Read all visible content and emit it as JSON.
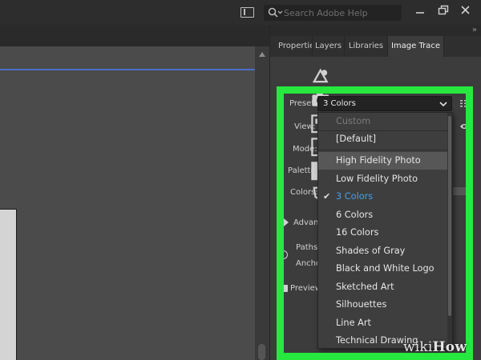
{
  "help_search": {
    "placeholder": "Search Adobe Help",
    "icon": "search-icon"
  },
  "window_controls": [
    "minimize-icon",
    "restore-icon",
    "close-icon"
  ],
  "panel_tabs": [
    {
      "label": "Propertie",
      "active": false
    },
    {
      "label": "Layers",
      "active": false
    },
    {
      "label": "Libraries",
      "active": false
    },
    {
      "label": "Image Trace",
      "active": true
    }
  ],
  "preset_icons": [
    "auto-color-icon",
    "high-color-icon",
    "low-color-icon",
    "grayscale-icon",
    "black-white-icon",
    "outline-icon"
  ],
  "image_trace": {
    "preset_label": "Preset:",
    "preset_value": "3 Colors",
    "view_label": "View:",
    "mode_label": "Mode:",
    "palette_label": "Palette:",
    "colors_label": "Colors:",
    "advanced_label": "Advanc",
    "paths_label": "Paths",
    "anchors_label": "Ancho",
    "preview_label": "Preview"
  },
  "preset_dropdown": {
    "items": [
      {
        "label": "Custom",
        "disabled": true
      },
      {
        "label": "[Default]"
      },
      {
        "label": "High Fidelity Photo",
        "hover": true
      },
      {
        "label": "Low Fidelity Photo"
      },
      {
        "label": "3 Colors",
        "checked": true
      },
      {
        "label": "6 Colors"
      },
      {
        "label": "16 Colors"
      },
      {
        "label": "Shades of Gray"
      },
      {
        "label": "Black and White Logo"
      },
      {
        "label": "Sketched Art"
      },
      {
        "label": "Silhouettes"
      },
      {
        "label": "Line Art"
      },
      {
        "label": "Technical Drawing"
      }
    ]
  },
  "colors": {
    "highlight": "#27e83e",
    "checked_item": "#4a9eea",
    "guide_line": "#4a6fc6"
  },
  "watermark": {
    "wiki": "wiki",
    "how": "How"
  }
}
